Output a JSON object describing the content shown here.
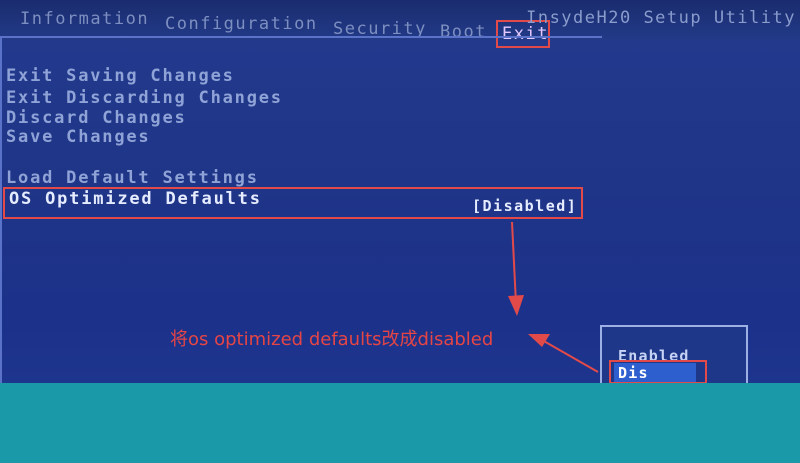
{
  "menu": {
    "tabs": [
      "Information",
      "Configuration",
      "Security",
      "Boot",
      "Exit"
    ],
    "active_tab": "Exit",
    "brand": "InsydeH20 Setup Utility"
  },
  "exit_menu": {
    "items": [
      "Exit Saving Changes",
      "Exit Discarding Changes",
      "Discard Changes",
      "Save Changes",
      "Load Default Settings",
      "OS Optimized Defaults"
    ],
    "os_optimized_value": "[Disabled]"
  },
  "annotation": {
    "caption": "将os optimized defaults改成disabled"
  },
  "popup": {
    "options": [
      "Enabled",
      "Dis"
    ],
    "selected": "Dis"
  },
  "colors": {
    "highlight": "#e24a4a",
    "bios_bg": "#1f3587",
    "bottom_band": "#1a9aa8"
  }
}
